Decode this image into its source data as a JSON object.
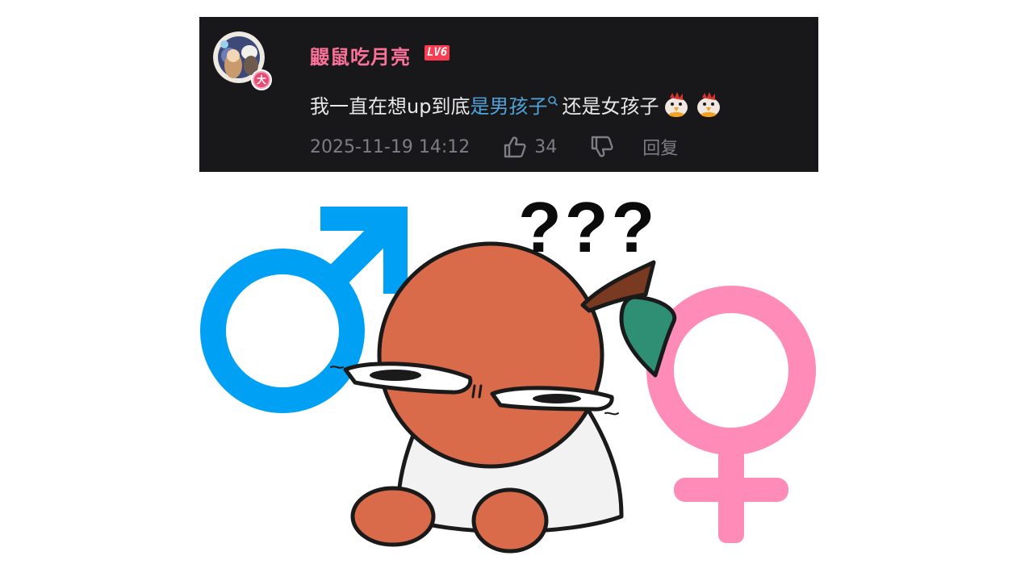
{
  "comment": {
    "username": "鼹鼠吃月亮",
    "level": "LV6",
    "avatar_badge": "大",
    "content_before": "我一直在想up到底",
    "content_highlight": "是男孩子",
    "content_after": "还是女孩子",
    "emojis": [
      "chick-emoji",
      "chick-emoji"
    ],
    "timestamp": "2025-11-19 14:12",
    "like_count": "34",
    "reply_label": "回复"
  },
  "illustration": {
    "caption": "???",
    "male_symbol_color": "#00a1f5",
    "female_symbol_color": "#ff8bb8",
    "character_color": "#d96a4a"
  },
  "colors": {
    "card_bg": "#18181b",
    "username": "#fb7299",
    "link": "#4fa3d9",
    "meta": "#7d7d82"
  }
}
